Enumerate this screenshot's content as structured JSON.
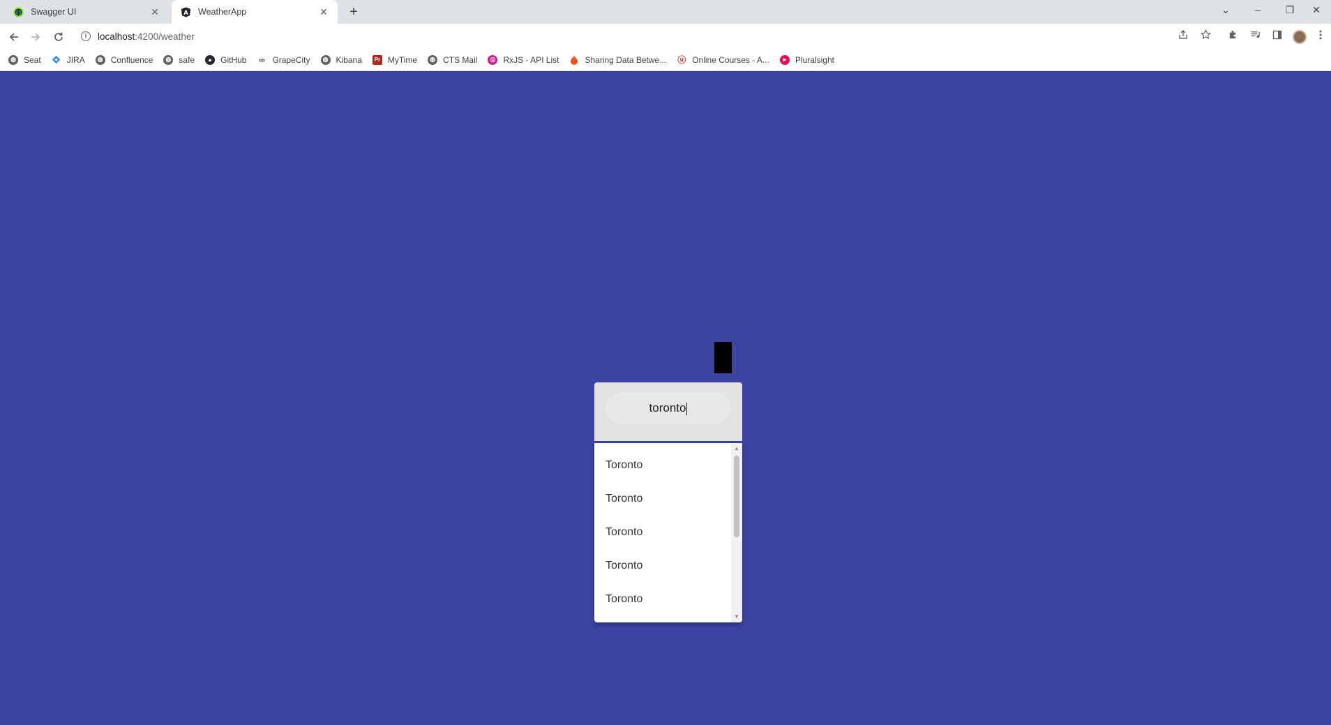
{
  "browser": {
    "tabs": [
      {
        "title": "Swagger UI",
        "icon": "swagger-icon",
        "active": false
      },
      {
        "title": "WeatherApp",
        "icon": "angular-icon",
        "active": true
      }
    ],
    "close_glyph": "✕",
    "new_tab_glyph": "+",
    "url_host": "localhost",
    "url_path": ":4200/weather",
    "window_controls": {
      "tab_search": "⌄",
      "minimize": "–",
      "restore": "❐",
      "close": "✕"
    }
  },
  "bookmarks": [
    {
      "label": "Seat",
      "icon": "globe-icon"
    },
    {
      "label": "JIRA",
      "icon": "jira-icon"
    },
    {
      "label": "Confluence",
      "icon": "globe-icon"
    },
    {
      "label": "safe",
      "icon": "globe-icon"
    },
    {
      "label": "GitHub",
      "icon": "github-icon"
    },
    {
      "label": "GrapeCity",
      "icon": "grapecity-icon"
    },
    {
      "label": "Kibana",
      "icon": "globe-icon"
    },
    {
      "label": "MyTime",
      "icon": "mytime-icon"
    },
    {
      "label": "CTS Mail",
      "icon": "globe-icon"
    },
    {
      "label": "RxJS - API List",
      "icon": "rxjs-icon"
    },
    {
      "label": "Sharing Data Betwe...",
      "icon": "flame-icon"
    },
    {
      "label": "Online Courses - A...",
      "icon": "udemy-icon"
    },
    {
      "label": "Pluralsight",
      "icon": "pluralsight-icon"
    }
  ],
  "search": {
    "value": "toronto"
  },
  "suggestions": [
    "Toronto",
    "Toronto",
    "Toronto",
    "Toronto",
    "Toronto"
  ],
  "colors": {
    "page_background": "#3c43a0",
    "search_card": "#e2e2e2",
    "dropdown": "#ffffff"
  }
}
